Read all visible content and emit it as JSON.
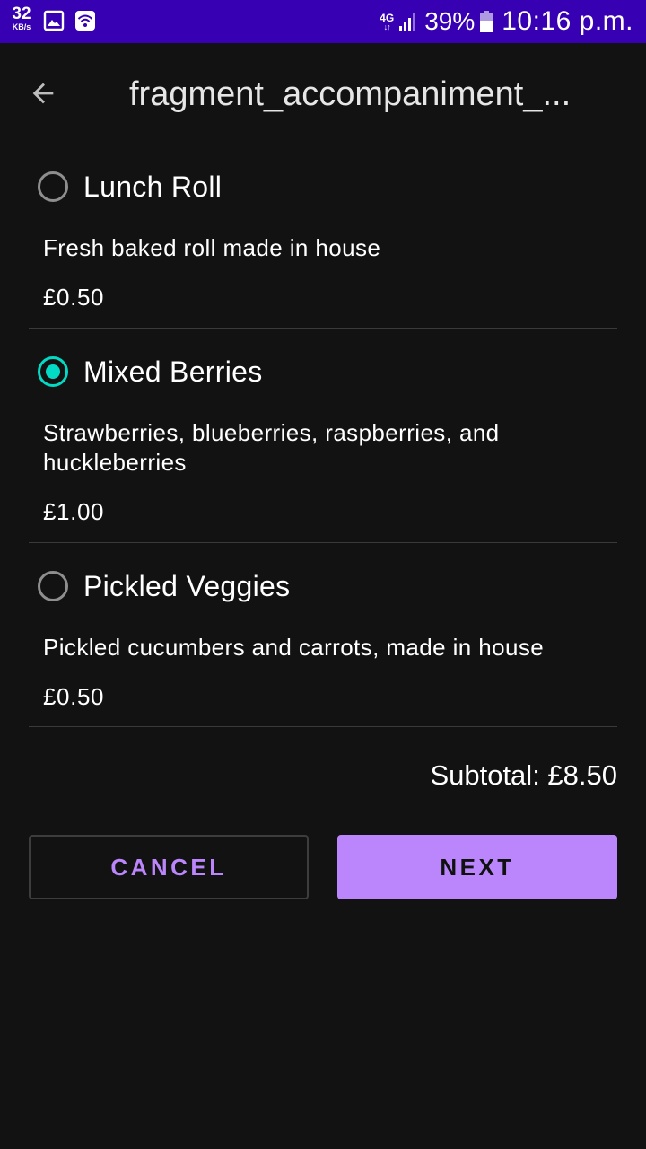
{
  "status_bar": {
    "speed_value": "32",
    "speed_unit": "KB/s",
    "network": "4G",
    "network_arrows": "↓↑",
    "battery_percent": "39%",
    "time": "10:16 p.m."
  },
  "app_bar": {
    "title": "fragment_accompaniment_..."
  },
  "options": [
    {
      "name": "Lunch Roll",
      "description": "Fresh baked roll made in house",
      "price": "£0.50",
      "selected": false
    },
    {
      "name": "Mixed Berries",
      "description": "Strawberries, blueberries, raspberries, and huckleberries",
      "price": "£1.00",
      "selected": true
    },
    {
      "name": "Pickled Veggies",
      "description": "Pickled cucumbers and carrots, made in house",
      "price": "£0.50",
      "selected": false
    }
  ],
  "subtotal": "Subtotal: £8.50",
  "buttons": {
    "cancel": "CANCEL",
    "next": "NEXT"
  },
  "colors": {
    "status_bar": "#3700b3",
    "background": "#121212",
    "accent_radio": "#03dac5",
    "primary": "#bb86fc"
  },
  "icons": {
    "back": "arrow-left-icon",
    "radio_unchecked": "radio-unchecked-icon",
    "radio_checked": "radio-checked-icon"
  }
}
